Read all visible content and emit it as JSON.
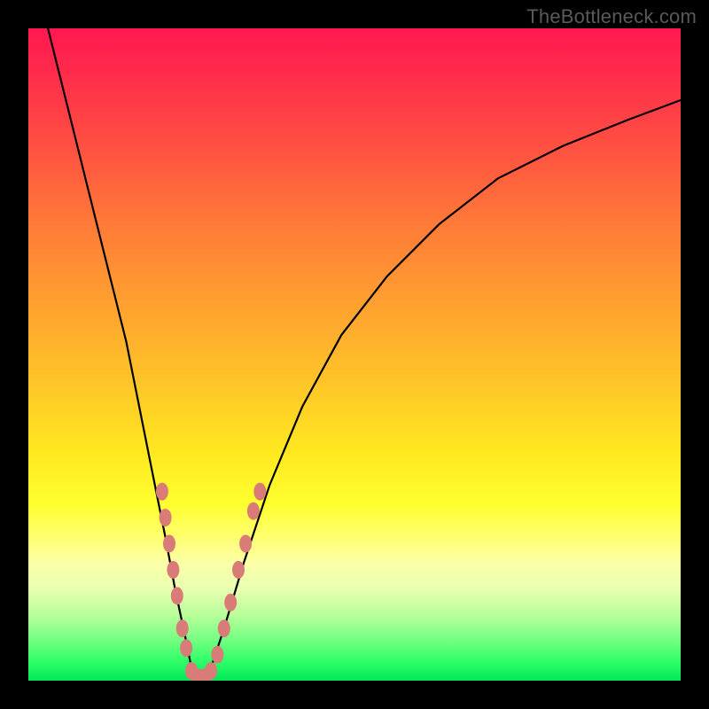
{
  "watermark": "TheBottleneck.com",
  "chart_data": {
    "type": "line",
    "title": "",
    "xlabel": "",
    "ylabel": "",
    "xlim": [
      0,
      100
    ],
    "ylim": [
      0,
      100
    ],
    "series": [
      {
        "name": "bottleneck-curve",
        "x": [
          3,
          6,
          9,
          12,
          15,
          17,
          19,
          21,
          22.5,
          24,
          25,
          26,
          28,
          30,
          33,
          37,
          42,
          48,
          55,
          63,
          72,
          82,
          92,
          100
        ],
        "y": [
          100,
          88,
          76,
          64,
          52,
          42,
          32,
          22,
          14,
          7,
          2,
          0,
          2,
          8,
          18,
          30,
          42,
          53,
          62,
          70,
          77,
          82,
          86,
          89
        ]
      }
    ],
    "markers": {
      "name": "highlighted-points",
      "color": "#d97b77",
      "points": [
        {
          "x": 20.5,
          "y": 29
        },
        {
          "x": 21.0,
          "y": 25
        },
        {
          "x": 21.6,
          "y": 21
        },
        {
          "x": 22.2,
          "y": 17
        },
        {
          "x": 22.8,
          "y": 13
        },
        {
          "x": 23.6,
          "y": 8
        },
        {
          "x": 24.2,
          "y": 5
        },
        {
          "x": 25.0,
          "y": 1.5
        },
        {
          "x": 26.0,
          "y": 0.5
        },
        {
          "x": 27.0,
          "y": 0.5
        },
        {
          "x": 28.0,
          "y": 1.5
        },
        {
          "x": 29.0,
          "y": 4
        },
        {
          "x": 30.0,
          "y": 8
        },
        {
          "x": 31.0,
          "y": 12
        },
        {
          "x": 32.2,
          "y": 17
        },
        {
          "x": 33.3,
          "y": 21
        },
        {
          "x": 34.5,
          "y": 26
        },
        {
          "x": 35.5,
          "y": 29
        }
      ]
    }
  }
}
